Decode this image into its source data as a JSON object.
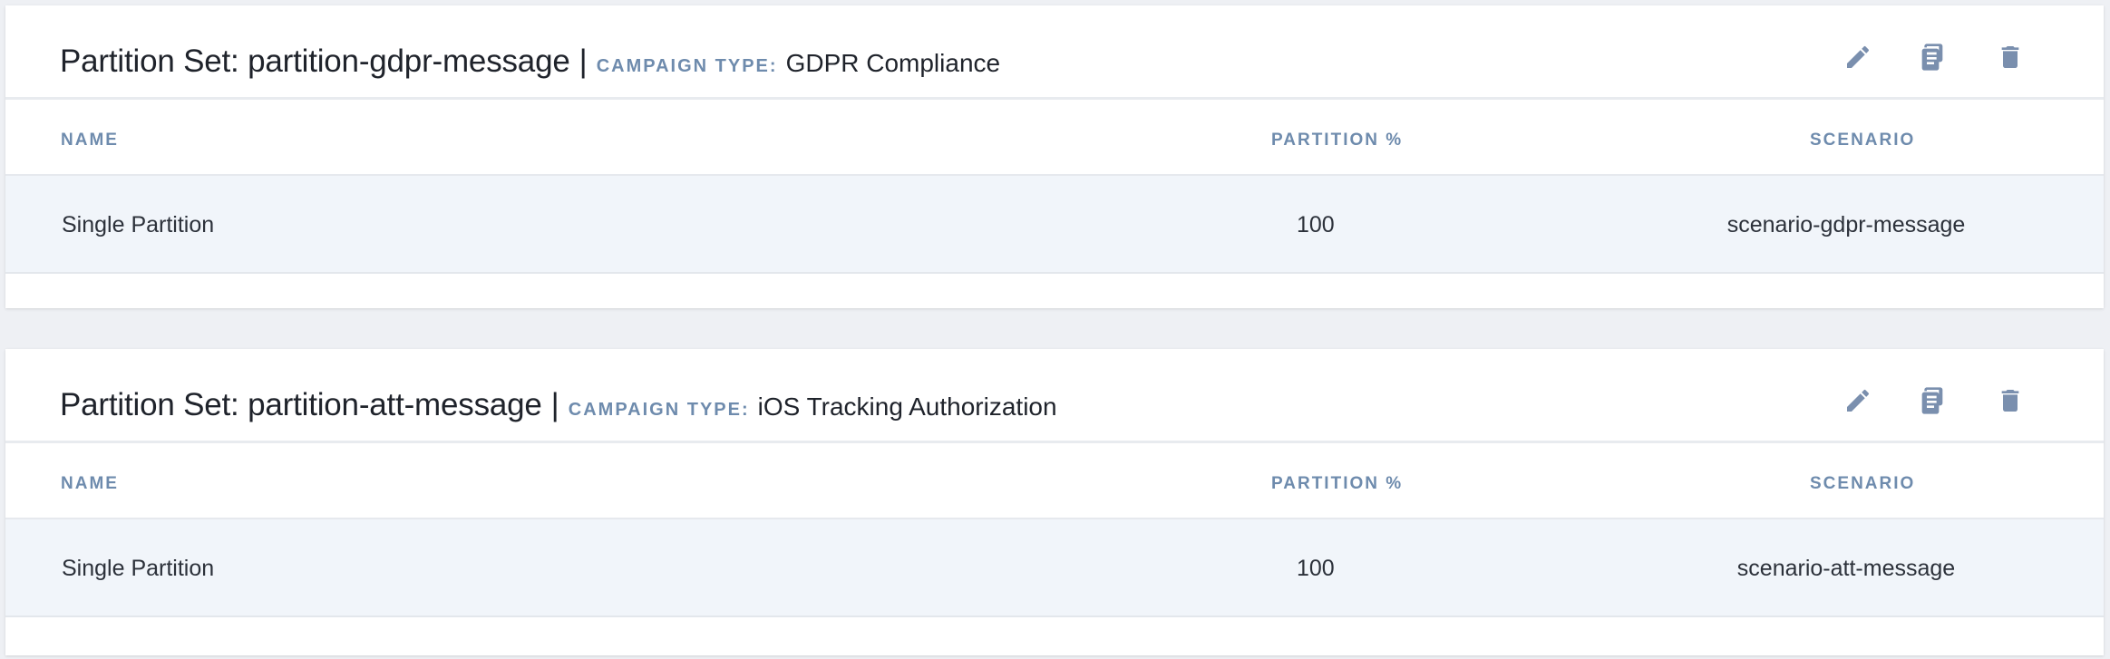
{
  "partition_sets": [
    {
      "title": "Partition Set: partition-gdpr-message",
      "separator": "|",
      "campaign_type_label": "CAMPAIGN TYPE:",
      "campaign_type_value": "GDPR Compliance",
      "columns": {
        "name": "NAME",
        "partition": "PARTITION %",
        "scenario": "SCENARIO"
      },
      "rows": [
        {
          "name": "Single Partition",
          "partition": "100",
          "scenario": "scenario-gdpr-message"
        }
      ],
      "actions": {
        "edit": "edit-icon",
        "copy": "copy-icon",
        "delete": "trash-icon"
      }
    },
    {
      "title": "Partition Set: partition-att-message",
      "separator": "|",
      "campaign_type_label": "CAMPAIGN TYPE:",
      "campaign_type_value": "iOS Tracking Authorization",
      "columns": {
        "name": "NAME",
        "partition": "PARTITION %",
        "scenario": "SCENARIO"
      },
      "rows": [
        {
          "name": "Single Partition",
          "partition": "100",
          "scenario": "scenario-att-message"
        }
      ],
      "actions": {
        "edit": "edit-icon",
        "copy": "copy-icon",
        "delete": "trash-icon"
      }
    }
  ],
  "colors": {
    "accent_label": "#6e8bad",
    "icon": "#7a8fae",
    "row_bg": "#f1f5fa",
    "page_bg": "#eef0f4"
  }
}
